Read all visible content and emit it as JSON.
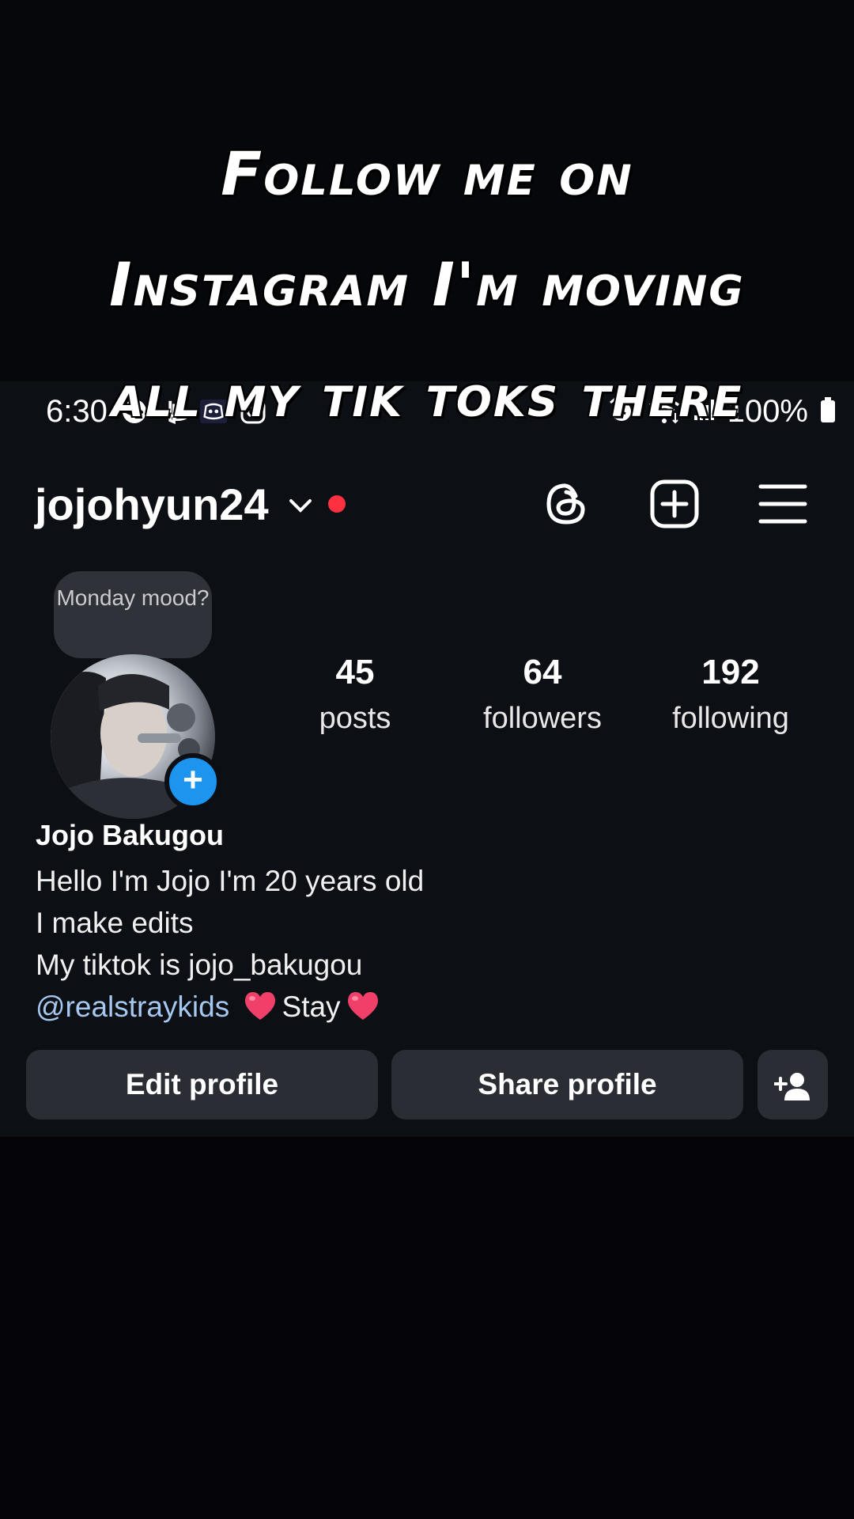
{
  "overlay": {
    "lines": [
      "Follow me on",
      "Instagram I'm moving",
      "all my tik toks there"
    ]
  },
  "status_bar": {
    "time": "6:30",
    "left_icons": [
      "face-icon",
      "playstation-icon",
      "discord-icon",
      "instagram-icon"
    ],
    "right_icons": [
      "alarm-icon",
      "wifi-icon",
      "signal-icon",
      "battery-icon"
    ],
    "battery": "100%"
  },
  "header": {
    "username": "jojohyun24",
    "icons": [
      "threads-icon",
      "create-icon",
      "menu-icon"
    ]
  },
  "profile": {
    "note": "Monday mood?",
    "stats": [
      {
        "value": "45",
        "label": "posts"
      },
      {
        "value": "64",
        "label": "followers"
      },
      {
        "value": "192",
        "label": "following"
      }
    ],
    "full_name": "Jojo Bakugou",
    "bio_lines": [
      "Hello I'm Jojo I'm 20 years old",
      "I make edits",
      "My tiktok is jojo_bakugou"
    ],
    "bio_mention": "@realstraykids",
    "bio_tail": "Stay"
  },
  "actions": {
    "edit_label": "Edit profile",
    "share_label": "Share profile"
  },
  "colors": {
    "background": "#0c0f14",
    "button": "#2a2d33",
    "accent_blue": "#1d95ee",
    "mention": "#a6c7ef",
    "heart": "#f0406a",
    "live_dot": "#ff3040"
  }
}
